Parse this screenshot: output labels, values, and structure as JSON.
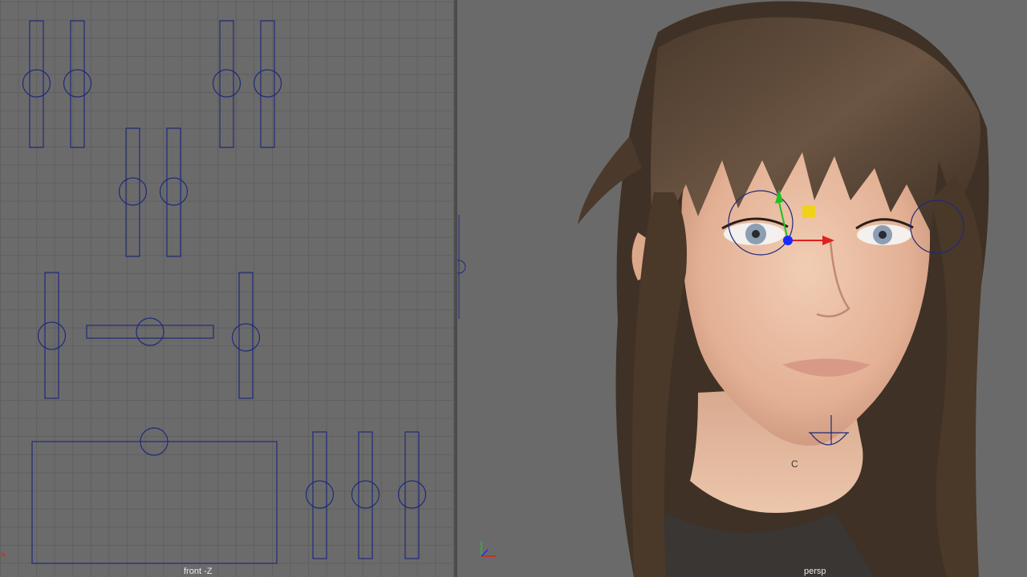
{
  "viewports": {
    "front": {
      "label": "front -Z"
    },
    "persp": {
      "label": "persp",
      "annotation": "C"
    }
  },
  "icons": {
    "axis": "axis-gizmo-icon",
    "move": "move-manipulator-icon"
  },
  "colors": {
    "grid_bg": "#6b6b6b",
    "grid_line": "#5f5f5f",
    "controller": "#1f2a7a",
    "persp_bg": "#6a6a6a",
    "label": "#e8e8e8"
  }
}
